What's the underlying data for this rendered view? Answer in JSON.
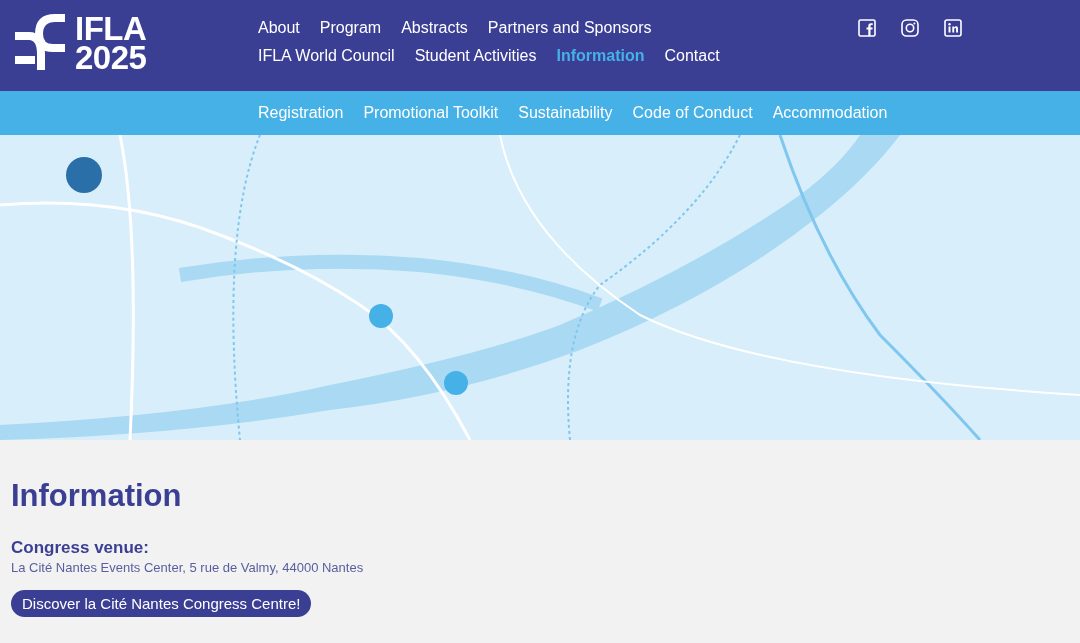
{
  "logo": {
    "line_1": "IFLA",
    "line_2": "2025"
  },
  "main_nav": [
    {
      "label": "About",
      "selected": false
    },
    {
      "label": "Program",
      "selected": false
    },
    {
      "label": "Abstracts",
      "selected": false
    },
    {
      "label": "Partners and Sponsors",
      "selected": false
    },
    {
      "label": "IFLA World Council",
      "selected": false
    },
    {
      "label": "Student Activities",
      "selected": false
    },
    {
      "label": "Information",
      "selected": true
    },
    {
      "label": "Contact",
      "selected": false
    }
  ],
  "social_links": [
    {
      "kind": "facebook"
    },
    {
      "kind": "instagram"
    },
    {
      "kind": "linkedin"
    }
  ],
  "sub_nav": [
    "Registration",
    "Promotional Toolkit",
    "Sustainability",
    "Code of Conduct",
    "Accommodation"
  ],
  "content": {
    "heading": "Information",
    "venue_label": "Congress venue:",
    "venue_address": "La Cité Nantes Events Center, 5 rue de Valmy, 44000 Nantes",
    "button": "Discover la Cité Nantes Congress Centre!"
  }
}
